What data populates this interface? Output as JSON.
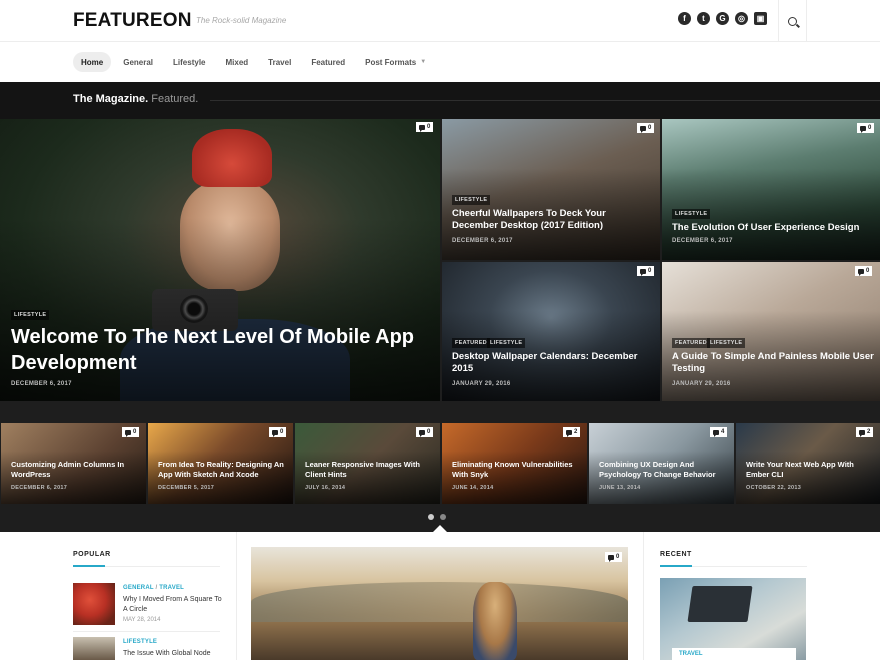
{
  "header": {
    "logo": "FEATUREON",
    "tagline": "The Rock-solid Magazine",
    "socials": [
      {
        "name": "facebook-icon",
        "glyph": "f"
      },
      {
        "name": "twitter-icon",
        "glyph": "t"
      },
      {
        "name": "google-icon",
        "glyph": "G"
      },
      {
        "name": "dribbble-icon",
        "glyph": "◎"
      },
      {
        "name": "instagram-icon",
        "glyph": "▣"
      }
    ]
  },
  "nav": {
    "items": [
      "Home",
      "General",
      "Lifestyle",
      "Mixed",
      "Travel",
      "Featured",
      "Post Formats"
    ]
  },
  "magazine": {
    "title": "The Magazine.",
    "subtitle": "Featured."
  },
  "hero": {
    "tag": "LIFESTYLE",
    "title": "Welcome To The Next Level Of Mobile App Development",
    "date": "DECEMBER 6, 2017",
    "comments": "0"
  },
  "grid": [
    {
      "tags": [
        "LIFESTYLE"
      ],
      "title": "Cheerful Wallpapers To Deck Your December Desktop (2017 Edition)",
      "date": "DECEMBER 6, 2017",
      "comments": "0"
    },
    {
      "tags": [
        "LIFESTYLE"
      ],
      "title": "The Evolution Of User Experience Design",
      "date": "DECEMBER 6, 2017",
      "comments": "0"
    },
    {
      "tags": [
        "FEATURED",
        "LIFESTYLE"
      ],
      "title": "Desktop Wallpaper Calendars: December 2015",
      "date": "JANUARY 29, 2016",
      "comments": "0"
    },
    {
      "tags": [
        "FEATURED",
        "LIFESTYLE"
      ],
      "title": "A Guide To Simple And Painless Mobile User Testing",
      "date": "JANUARY 29, 2016",
      "comments": "0"
    }
  ],
  "slider": [
    {
      "title": "Customizing Admin Columns In WordPress",
      "date": "DECEMBER 6, 2017",
      "comments": "0"
    },
    {
      "title": "From Idea To Reality: Designing An App With Sketch And Xcode",
      "date": "DECEMBER 5, 2017",
      "comments": "0"
    },
    {
      "title": "Leaner Responsive Images With Client Hints",
      "date": "JULY 16, 2014",
      "comments": "0"
    },
    {
      "title": "Eliminating Known Vulnerabilities With Snyk",
      "date": "JUNE 14, 2014",
      "comments": "2"
    },
    {
      "title": "Combining UX Design And Psychology To Change Behavior",
      "date": "JUNE 13, 2014",
      "comments": "4"
    },
    {
      "title": "Write Your Next Web App With Ember CLI",
      "date": "OCTOBER 22, 2013",
      "comments": "2"
    }
  ],
  "popular": {
    "title": "POPULAR",
    "items": [
      {
        "cat1": "GENERAL",
        "cat2": "TRAVEL",
        "title": "Why I Moved From A Square To A Circle",
        "date": "MAY 28, 2014"
      },
      {
        "cat1": "LIFESTYLE",
        "cat2": "",
        "title": "The Issue With Global Node",
        "date": ""
      }
    ]
  },
  "featured_post": {
    "comments": "0"
  },
  "recent": {
    "title": "RECENT",
    "tag": "TRAVEL"
  },
  "colors": {
    "accent": "#27a8c8",
    "dark": "#1e1e1e"
  }
}
